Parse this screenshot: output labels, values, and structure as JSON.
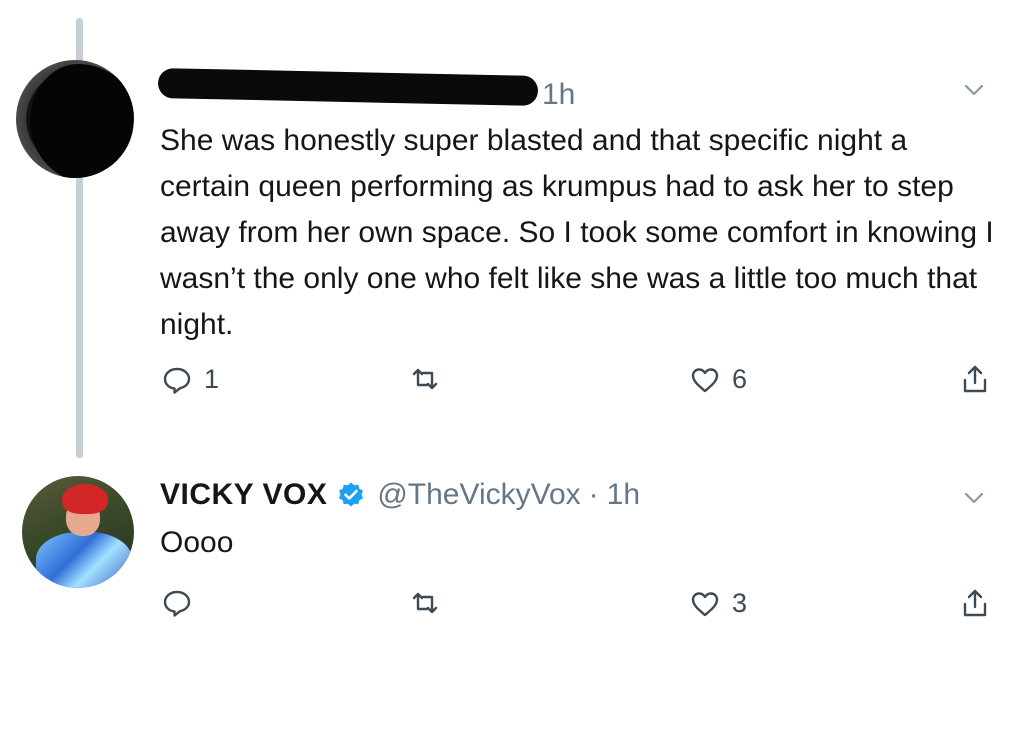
{
  "colors": {
    "text": "#14171a",
    "secondary": "#657786",
    "thread_line": "#c4cfd8",
    "verified": "#1da1f2"
  },
  "tweet1": {
    "time": "1h",
    "text": "She was honestly super blasted and that specific night a certain queen performing as krumpus had to ask her to step away from her own space. So I took some comfort in knowing I wasn’t the only one who felt like she was a little too much that night.",
    "reply_count": "1",
    "like_count": "6"
  },
  "tweet2": {
    "display_name": "VICKY VOX",
    "handle": "@TheVickyVox",
    "separator": "·",
    "time": "1h",
    "text": "Oooo",
    "like_count": "3"
  },
  "icons": [
    "reply-icon",
    "retweet-icon",
    "like-icon",
    "share-icon",
    "chevron-down-icon",
    "verified-icon"
  ]
}
